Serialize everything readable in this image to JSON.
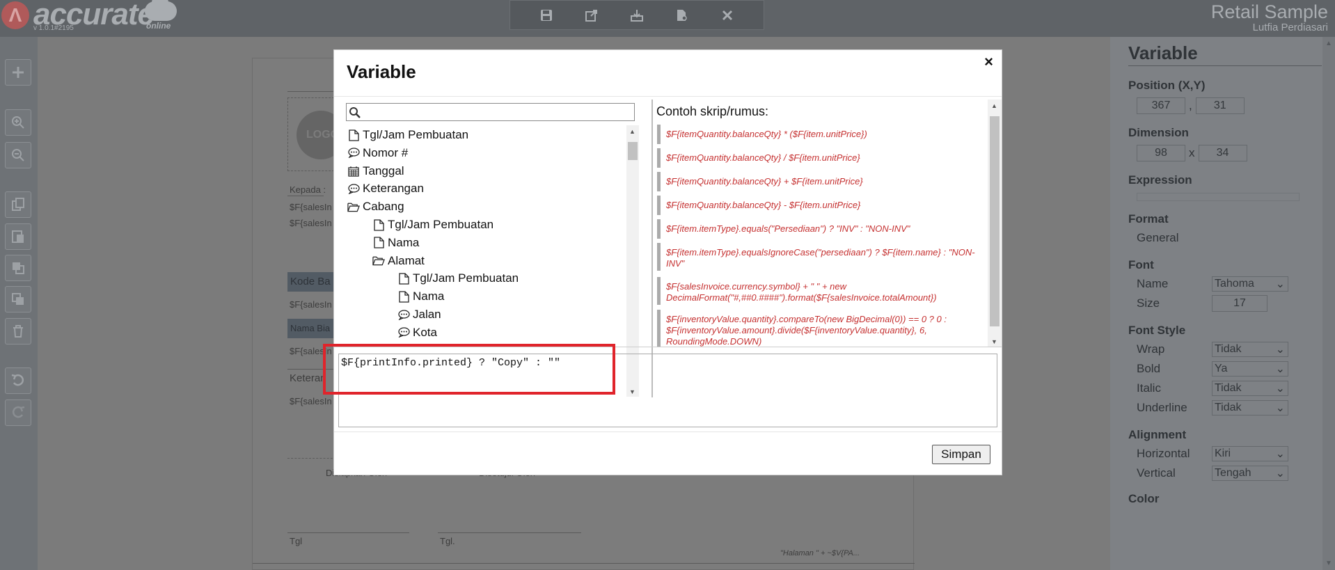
{
  "app": {
    "logo_mark": "Λ",
    "logo_text": "accurate",
    "logo_online": "online",
    "version": "v 1.0.1#2195",
    "company_name": "Retail Sample",
    "user_name": "Lutfia Perdiasari"
  },
  "toolbar": {
    "icons": [
      "save-icon",
      "export-icon",
      "import-icon",
      "preview-icon",
      "close-icon"
    ]
  },
  "left_tools": [
    "add-icon",
    "zoom-in-icon",
    "zoom-out-icon",
    "copy-icon",
    "paste-icon",
    "bring-front-icon",
    "send-back-icon",
    "delete-icon",
    "undo-icon",
    "redo-icon"
  ],
  "page": {
    "logo_text": "LOGO",
    "kepada": "Kepada :",
    "sales1": "$F{salesIn",
    "sales2": "$F{salesIn",
    "kode_band": "Kode Ba",
    "sales3": "$F{salesIn",
    "nama_band": "Nama Bia",
    "sales4": "$F{salesIn",
    "ketera_band": "Keteran",
    "sales5": "$F{salesIn",
    "disiapkan": "Disiapkan Oleh",
    "disetujui": "Disetujui Oleh",
    "tgl1": "Tgl",
    "tgl2": "Tgl.",
    "halaman": "\"Halaman \" + ~$V{PA..."
  },
  "right_panel": {
    "title": "Variable",
    "position_label": "Position (X,Y)",
    "pos_x": "367",
    "pos_sep": ",",
    "pos_y": "31",
    "dimension_label": "Dimension",
    "dim_w": "98",
    "dim_sep": "x",
    "dim_h": "34",
    "expression_label": "Expression",
    "format_label": "Format",
    "format_value": "General",
    "font_label": "Font",
    "font_name_label": "Name",
    "font_name_value": "Tahoma",
    "font_size_label": "Size",
    "font_size_value": "17",
    "font_style_label": "Font Style",
    "wrap_label": "Wrap",
    "wrap_value": "Tidak",
    "bold_label": "Bold",
    "bold_value": "Ya",
    "italic_label": "Italic",
    "italic_value": "Tidak",
    "underline_label": "Underline",
    "underline_value": "Tidak",
    "alignment_label": "Alignment",
    "horizontal_label": "Horizontal",
    "horizontal_value": "Kiri",
    "vertical_label": "Vertical",
    "vertical_value": "Tengah",
    "color_label": "Color"
  },
  "modal": {
    "title": "Variable",
    "close": "×",
    "search_placeholder": "",
    "tree": [
      {
        "label": "Tgl/Jam Pembuatan",
        "icon": "file-icon",
        "level": 0
      },
      {
        "label": "Nomor #",
        "icon": "comment-icon",
        "level": 0
      },
      {
        "label": "Tanggal",
        "icon": "calendar-icon",
        "level": 0
      },
      {
        "label": "Keterangan",
        "icon": "comment-icon",
        "level": 0
      },
      {
        "label": "Cabang",
        "icon": "folder-open-icon",
        "level": 0
      },
      {
        "label": "Tgl/Jam Pembuatan",
        "icon": "file-icon",
        "level": 1
      },
      {
        "label": "Nama",
        "icon": "file-icon",
        "level": 1
      },
      {
        "label": "Alamat",
        "icon": "folder-open-icon",
        "level": 1
      },
      {
        "label": "Tgl/Jam Pembuatan",
        "icon": "file-icon",
        "level": 2
      },
      {
        "label": "Nama",
        "icon": "file-icon",
        "level": 2
      },
      {
        "label": "Jalan",
        "icon": "comment-icon",
        "level": 2
      },
      {
        "label": "Kota",
        "icon": "comment-icon",
        "level": 2
      }
    ],
    "examples_title": "Contoh skrip/rumus:",
    "examples": [
      "$F{itemQuantity.balanceQty} * ($F{item.unitPrice})",
      "$F{itemQuantity.balanceQty} / $F{item.unitPrice}",
      "$F{itemQuantity.balanceQty} + $F{item.unitPrice}",
      "$F{itemQuantity.balanceQty} - $F{item.unitPrice}",
      "$F{item.itemType}.equals(\"Persediaan\") ? \"INV\" : \"NON-INV\"",
      "$F{item.itemType}.equalsIgnoreCase(\"persediaan\") ? $F{item.name} : \"NON-INV\"",
      "$F{salesInvoice.currency.symbol} + \" \" + new DecimalFormat(\"#,##0.####\").format($F{salesInvoice.totalAmount})",
      "$F{inventoryValue.quantity}.compareTo(new BigDecimal(0)) == 0 ? 0 : $F{inventoryValue.amount}.divide($F{inventoryValue.quantity}, 6, RoundingMode.DOWN)"
    ],
    "expression": "$F{printInfo.printed} ? \"Copy\" : \"\"",
    "save_label": "Simpan"
  }
}
